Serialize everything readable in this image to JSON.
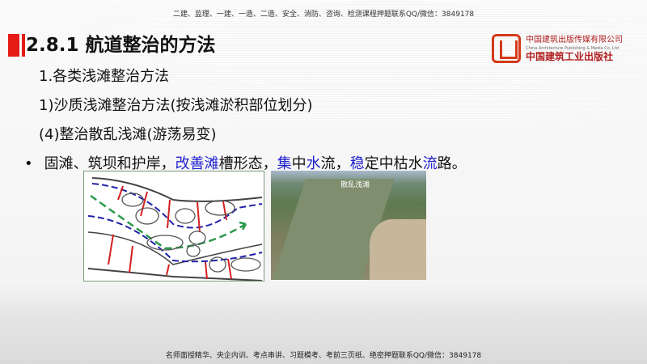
{
  "header_note": "二建、监理、一建、一造、二造、安全、消防、咨询、检测课程押题联系QQ/微信：3849178",
  "title": "2.8.1 航道整治的方法",
  "logo": {
    "cn": "中国建筑出版传媒有限公司",
    "en": "China Architecture Publishing & Media Co.,Ltd",
    "cn2": "中国建筑工业出版社"
  },
  "lines": [
    "1.各类浅滩整治方法",
    "1)沙质浅滩整治方法(按浅滩淤积部位划分)",
    "(4)整治散乱浅滩(游荡易变)"
  ],
  "bullet": {
    "marker": "•",
    "segments": [
      {
        "text": "固滩、筑坝和护岸，",
        "hl": false
      },
      {
        "text": "改善滩",
        "hl": true
      },
      {
        "text": "槽形态，",
        "hl": false
      },
      {
        "text": "集",
        "hl": true
      },
      {
        "text": "中",
        "hl": false
      },
      {
        "text": "水",
        "hl": true
      },
      {
        "text": "流，",
        "hl": false
      },
      {
        "text": "稳",
        "hl": true
      },
      {
        "text": "定中枯水",
        "hl": false
      },
      {
        "text": "流",
        "hl": true
      },
      {
        "text": "路。",
        "hl": false
      }
    ]
  },
  "photo_label": "散乱浅滩",
  "footer_note": "名师面授精华、央企内训、考点串讲、习题模考、考前三页纸、绝密押题联系QQ/微信：3849178",
  "colors": {
    "accent": "#e41b17",
    "highlight": "#1f1fd0"
  }
}
